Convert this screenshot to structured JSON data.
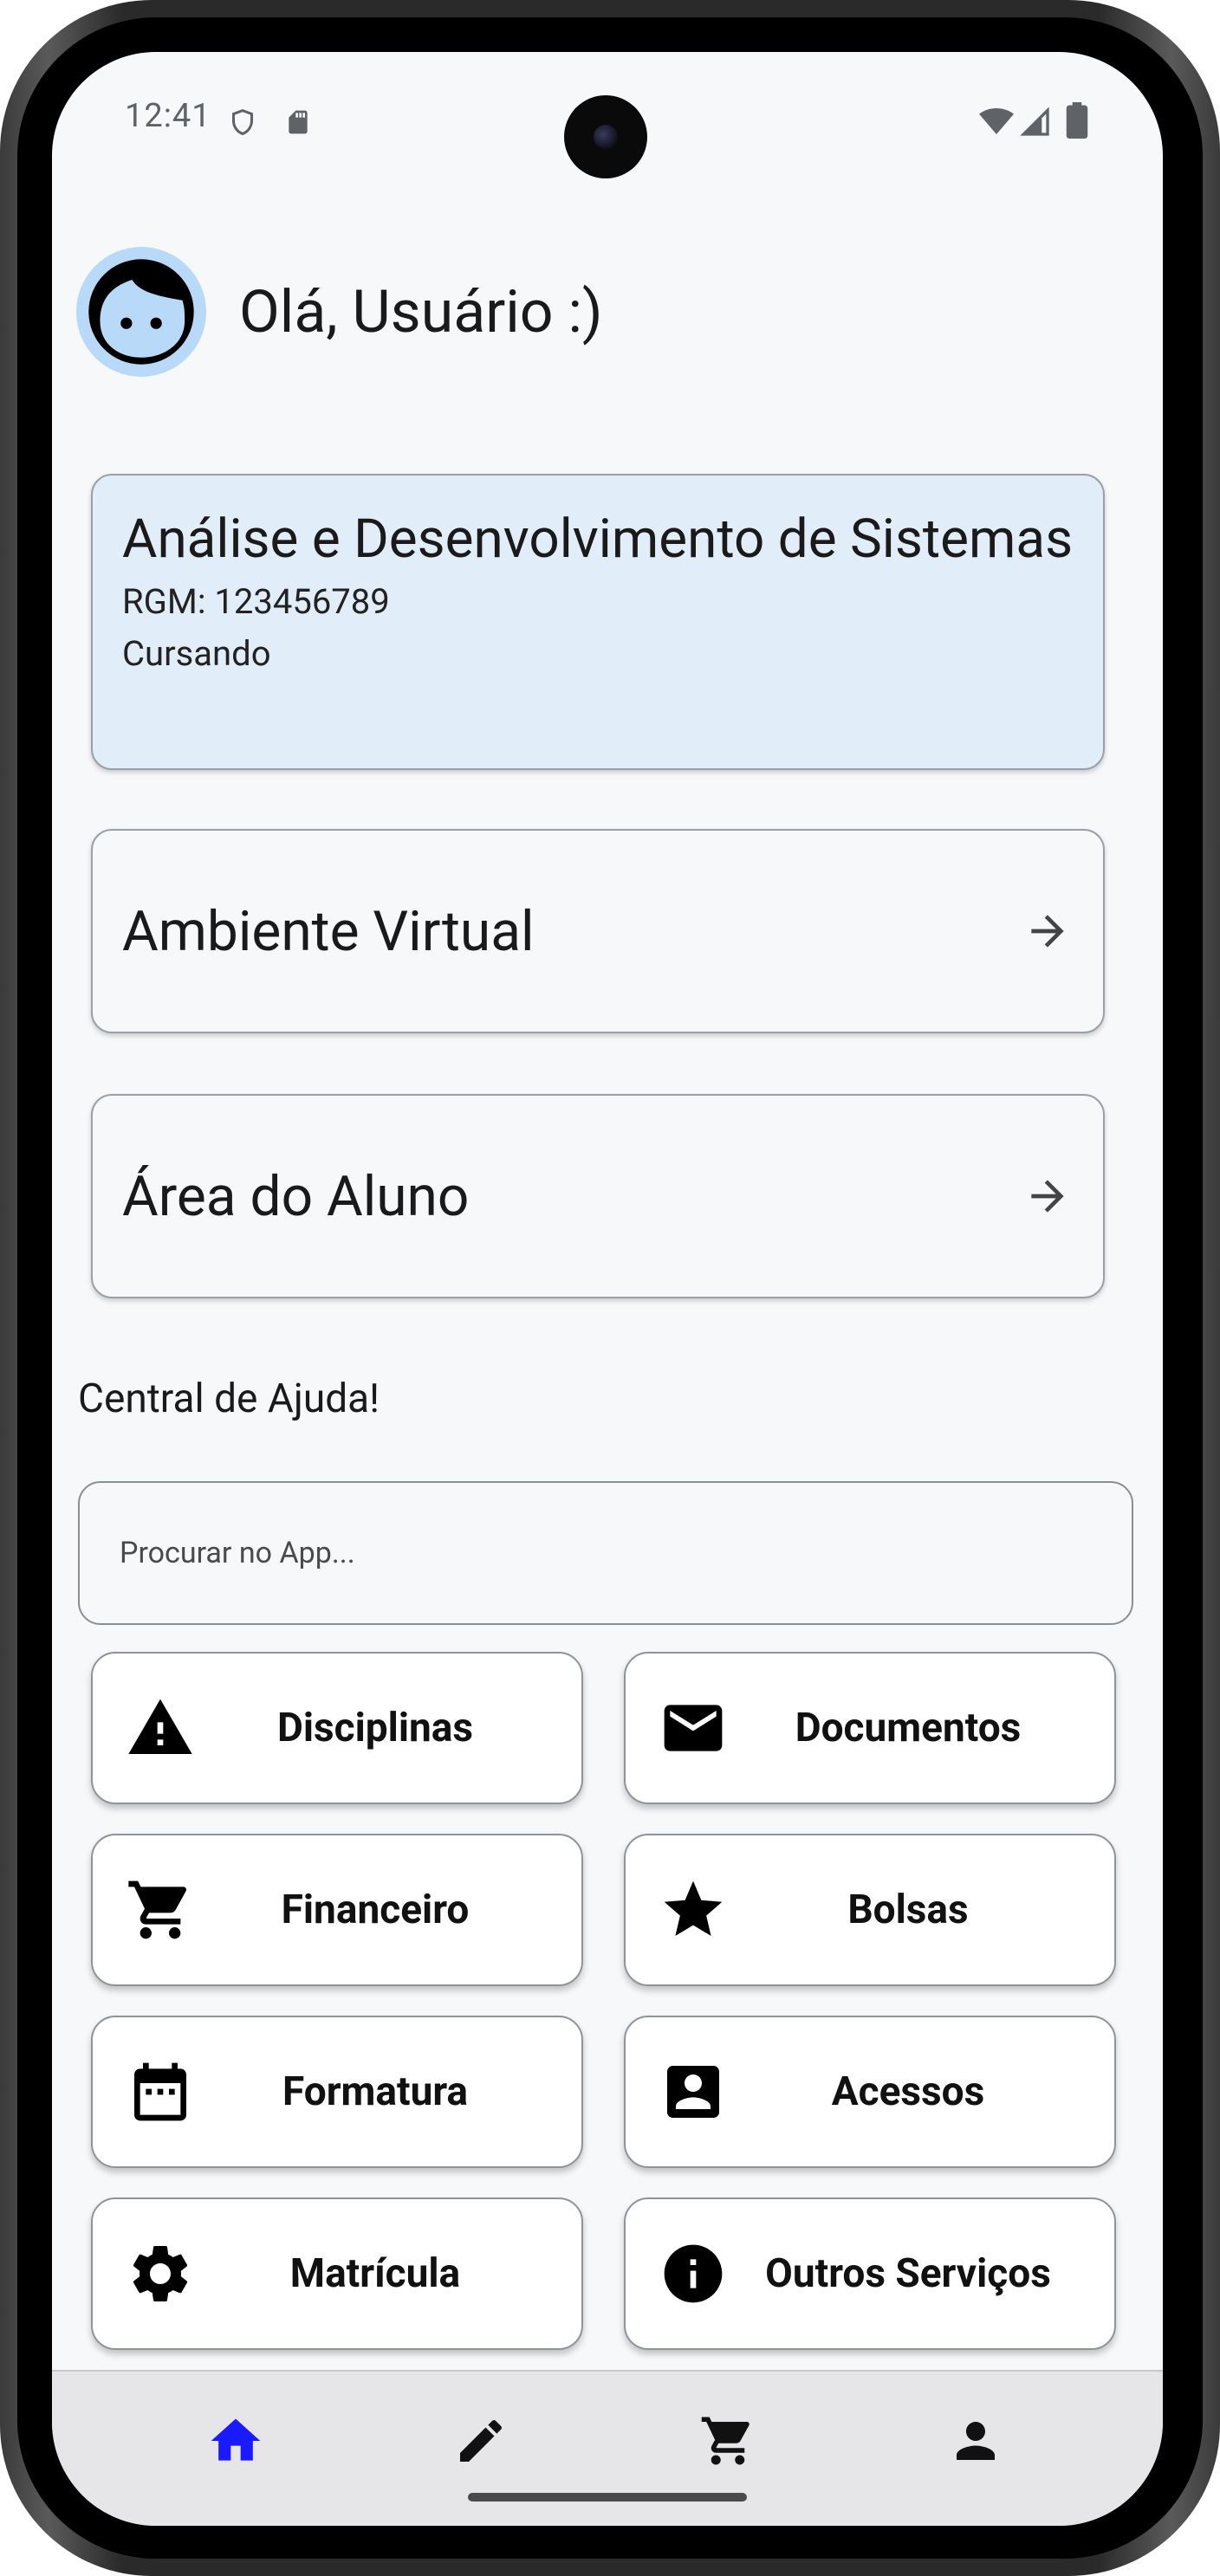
{
  "status_bar": {
    "time": "12:41"
  },
  "header": {
    "greeting": "Olá, Usuário :)"
  },
  "course": {
    "title": "Análise e Desenvolvimento de Sistemas",
    "rgm": "RGM: 123456789",
    "status": "Cursando"
  },
  "links": [
    {
      "label": "Ambiente Virtual",
      "icon": "arrow-forward-icon"
    },
    {
      "label": "Área do Aluno",
      "icon": "arrow-forward-icon"
    }
  ],
  "help": {
    "title": "Central de Ajuda!",
    "search_placeholder": "Procurar no App..."
  },
  "grid": [
    {
      "label": "Disciplinas",
      "icon": "warning-icon"
    },
    {
      "label": "Documentos",
      "icon": "mail-icon"
    },
    {
      "label": "Financeiro",
      "icon": "cart-icon"
    },
    {
      "label": "Bolsas",
      "icon": "star-icon"
    },
    {
      "label": "Formatura",
      "icon": "calendar-icon"
    },
    {
      "label": "Acessos",
      "icon": "contact-card-icon"
    },
    {
      "label": "Matrícula",
      "icon": "gear-icon"
    },
    {
      "label": "Outros Serviços",
      "icon": "info-icon"
    }
  ],
  "bottom_nav": [
    {
      "icon": "home-icon",
      "active": true
    },
    {
      "icon": "pencil-icon",
      "active": false
    },
    {
      "icon": "cart-icon",
      "active": false
    },
    {
      "icon": "person-icon",
      "active": false
    }
  ],
  "colors": {
    "nav_active": "#1a1aff",
    "nav_inactive": "#111111",
    "course_card_bg": "#e1eefa",
    "avatar_bg": "#b8d9f7"
  }
}
